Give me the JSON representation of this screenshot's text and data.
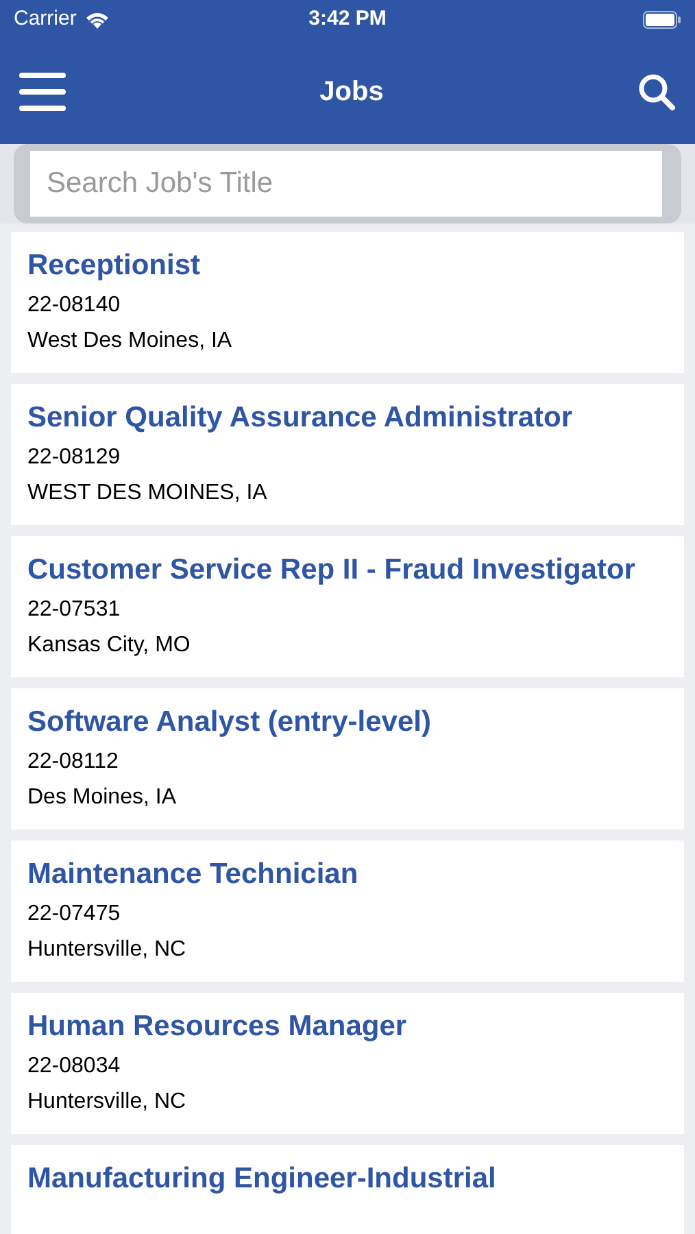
{
  "status_bar": {
    "carrier": "Carrier",
    "time": "3:42 PM"
  },
  "header": {
    "title": "Jobs"
  },
  "search": {
    "placeholder": "Search Job's Title"
  },
  "jobs": [
    {
      "title": "Receptionist",
      "id": "22-08140",
      "location": "West Des Moines, IA"
    },
    {
      "title": "Senior Quality Assurance Administrator",
      "id": "22-08129",
      "location": "WEST DES MOINES, IA"
    },
    {
      "title": "Customer Service Rep II - Fraud Investigator",
      "id": "22-07531",
      "location": "Kansas City, MO"
    },
    {
      "title": "Software Analyst (entry-level)",
      "id": "22-08112",
      "location": "Des Moines, IA"
    },
    {
      "title": "Maintenance Technician",
      "id": "22-07475",
      "location": "Huntersville, NC"
    },
    {
      "title": "Human Resources Manager",
      "id": "22-08034",
      "location": "Huntersville, NC"
    },
    {
      "title": "Manufacturing Engineer-Industrial"
    }
  ]
}
